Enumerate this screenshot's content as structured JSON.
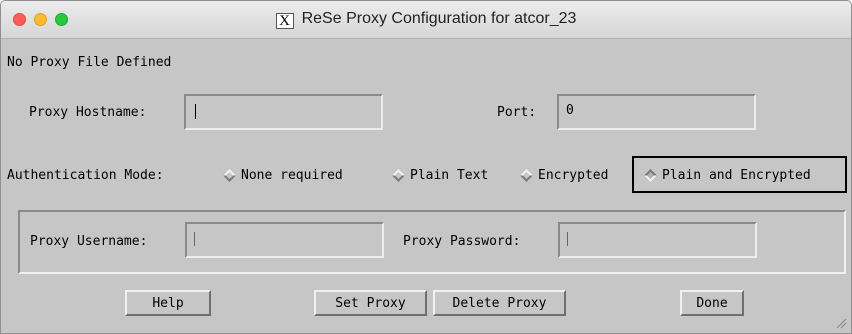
{
  "window": {
    "title": "ReSe Proxy Configuration for atcor_23",
    "title_icon": "x11-icon",
    "title_icon_glyph": "X"
  },
  "status_text": "No Proxy File Defined",
  "proxy": {
    "hostname_label": "Proxy Hostname:",
    "hostname_value": "",
    "port_label": "Port:",
    "port_value": "0"
  },
  "auth": {
    "label": "Authentication Mode:",
    "options": [
      {
        "label": "None required",
        "selected": false
      },
      {
        "label": "Plain Text",
        "selected": false
      },
      {
        "label": "Encrypted",
        "selected": false
      },
      {
        "label": "Plain and Encrypted",
        "selected": true
      }
    ]
  },
  "credentials": {
    "username_label": "Proxy Username:",
    "username_value": "",
    "password_label": "Proxy Password:",
    "password_value": ""
  },
  "buttons": {
    "help": "Help",
    "set_proxy": "Set Proxy",
    "delete_proxy": "Delete Proxy",
    "done": "Done"
  },
  "colors": {
    "window_bg": "#c6c6c6",
    "close": "#fc5f57",
    "minimize": "#fdbc2e",
    "maximize": "#28c840"
  }
}
